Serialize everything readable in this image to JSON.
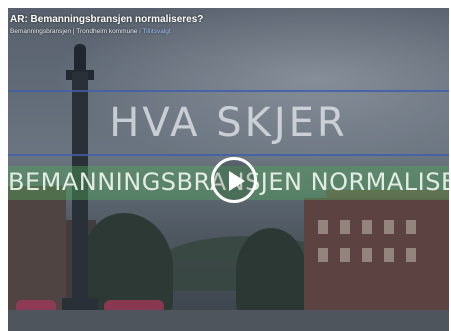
{
  "video": {
    "title": "AR: Bemanningsbransjen normaliseres?",
    "meta_prefix": "Bemanningsbransjen | Trondheim kommune",
    "meta_link": "i Tillitsvalgt",
    "headline": "HVA SKJER",
    "subheadline": "BEMANNINGSBRANSJEN NORMALISERES?",
    "play_icon": "play-icon"
  },
  "colors": {
    "band_green": "#50aa5a",
    "rule_blue": "#3f5fa8"
  }
}
